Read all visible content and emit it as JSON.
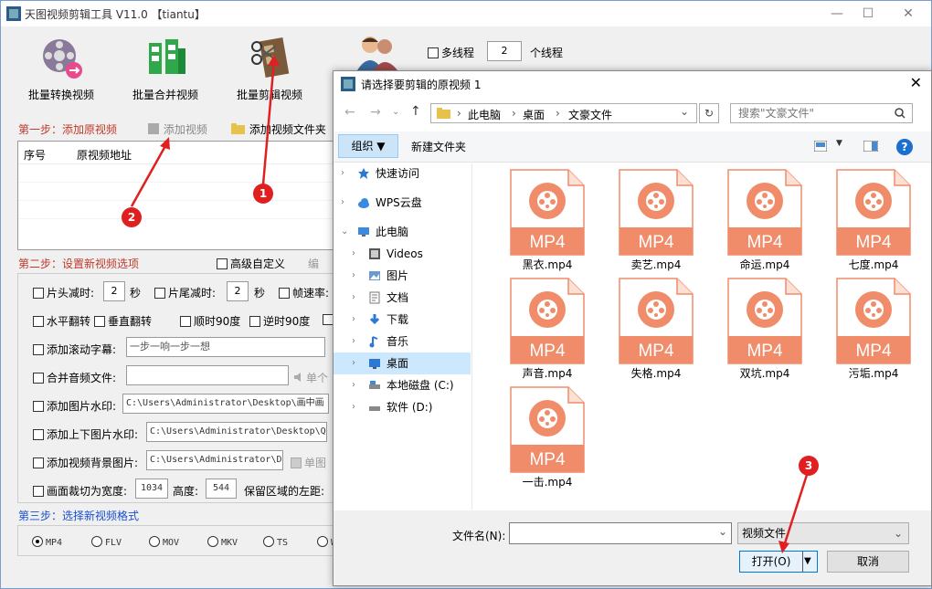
{
  "app": {
    "title": "天图视频剪辑工具 V11.0  【tiantu】",
    "toolbar": {
      "batch_convert": "批量转换视频",
      "batch_merge": "批量合并视频",
      "batch_cut": "批量剪辑视频",
      "multithread_label": "多线程",
      "thread_count": "2",
      "thread_unit": "个线程"
    },
    "step1": {
      "title": "第一步：添加原视频",
      "add_video": "添加视频",
      "add_folder": "添加视频文件夹",
      "table_headers": [
        "序号",
        "原视频地址"
      ]
    },
    "step2": {
      "title": "第二步：设置新视频选项",
      "advanced": "高级自定义",
      "edit": "编",
      "head_cut": "片头减时:",
      "head_val": "2",
      "sec1": "秒",
      "tail_cut": "片尾减时:",
      "tail_val": "2",
      "sec2": "秒",
      "fps": "帧速率:",
      "hflip": "水平翻转",
      "vflip": "垂直翻转",
      "rot_cw": "顺时90度",
      "rot_ccw": "逆时90度",
      "subtitle": "添加滚动字幕:",
      "subtitle_val": "一步一响一步一想",
      "merge_audio": "合并音频文件:",
      "single": "单个",
      "img_wm": "添加图片水印:",
      "img_wm_val": "C:\\Users\\Administrator\\Desktop\\画中画",
      "tb_wm": "添加上下图片水印:",
      "tb_wm_val": "C:\\Users\\Administrator\\Desktop\\Q",
      "bg_img": "添加视频背景图片:",
      "bg_img_val": "C:\\Users\\Administrator\\D",
      "single_img": "单图",
      "crop": "画面裁切为宽度:",
      "crop_w": "1034",
      "crop_h_label": "高度:",
      "crop_h": "544",
      "keep_left": "保留区域的左距:"
    },
    "step3": {
      "title": "第三步：选择新视频格式",
      "formats": [
        "MP4",
        "FLV",
        "MOV",
        "MKV",
        "TS",
        "W"
      ]
    }
  },
  "dialog": {
    "title": "请选择要剪辑的原视频 1",
    "path": [
      "此电脑",
      "桌面",
      "文豪文件"
    ],
    "search_placeholder": "搜索\"文豪文件\"",
    "organize": "组织 ▼",
    "new_folder": "新建文件夹",
    "nav": [
      {
        "label": "快速访问",
        "icon": "star-icon"
      },
      {
        "label": "WPS云盘",
        "icon": "cloud-icon"
      },
      {
        "label": "此电脑",
        "icon": "computer-icon"
      },
      {
        "label": "Videos",
        "icon": "video-folder-icon"
      },
      {
        "label": "图片",
        "icon": "pictures-folder-icon"
      },
      {
        "label": "文档",
        "icon": "documents-folder-icon"
      },
      {
        "label": "下载",
        "icon": "download-folder-icon"
      },
      {
        "label": "音乐",
        "icon": "music-folder-icon"
      },
      {
        "label": "桌面",
        "icon": "desktop-folder-icon"
      },
      {
        "label": "本地磁盘 (C:)",
        "icon": "drive-c-icon"
      },
      {
        "label": "软件 (D:)",
        "icon": "drive-d-icon"
      }
    ],
    "file_badge": "MP4",
    "files": [
      "黑衣.mp4",
      "卖艺.mp4",
      "命运.mp4",
      "七度.mp4",
      "声音.mp4",
      "失格.mp4",
      "双坑.mp4",
      "污垢.mp4",
      "一击.mp4"
    ],
    "filename_label": "文件名(N):",
    "filetype": "视频文件",
    "open": "打开(O)",
    "cancel": "取消"
  },
  "badges": [
    "1",
    "2",
    "3"
  ],
  "colors": {
    "mp4_accent": "#f08c6a",
    "annotation_red": "#e02020",
    "step_red": "#c0392b",
    "step_blue": "#1a4fd0"
  }
}
